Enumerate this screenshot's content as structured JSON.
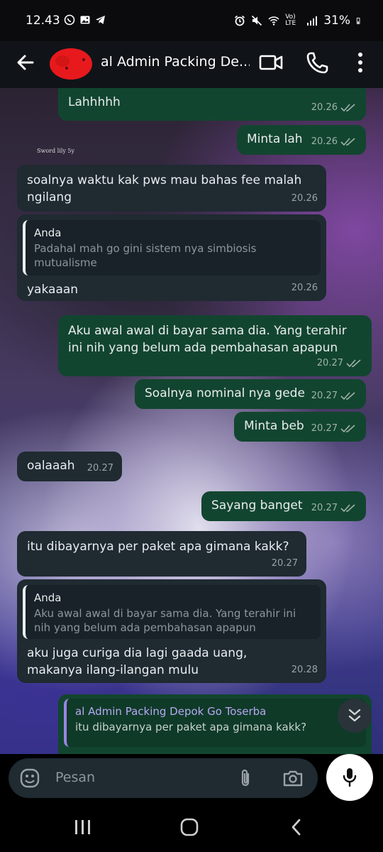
{
  "status_bar": {
    "time": "12.43",
    "battery": "31%",
    "network": "Vo) LTE",
    "icons": [
      "whatsapp-icon",
      "gallery-icon",
      "telegram-icon",
      "alarm-icon",
      "mute-icon",
      "wifi-icon",
      "signal-icon",
      "battery-icon"
    ]
  },
  "header": {
    "contact_name": "al Admin Packing De...",
    "icons": [
      "back-arrow-icon",
      "video-call-icon",
      "voice-call-icon",
      "more-vert-icon"
    ]
  },
  "chat": {
    "watermark": "Sword lily 5y",
    "messages": [
      {
        "direction": "out",
        "text": "Lahhhhh",
        "time": "20.26",
        "status": "read"
      },
      {
        "direction": "out",
        "text": "Minta lah",
        "time": "20.26",
        "status": "read"
      },
      {
        "direction": "in",
        "text": "soalnya waktu kak pws mau bahas fee malah ngilang",
        "time": "20.26"
      },
      {
        "direction": "in",
        "quote_name": "Anda",
        "quote_text": "Padahal mah go gini sistem nya simbiosis mutualisme",
        "text": "yakaaan",
        "time": "20.26"
      },
      {
        "direction": "out",
        "text": "Aku awal awal di bayar sama dia. Yang terahir ini nih yang  belum ada pembahasan apapun",
        "time": "20.27",
        "status": "read"
      },
      {
        "direction": "out",
        "text": "Soalnya nominal nya gede",
        "time": "20.27",
        "status": "read"
      },
      {
        "direction": "out",
        "text": "Minta beb",
        "time": "20.27",
        "status": "read"
      },
      {
        "direction": "in",
        "text": "oalaaah",
        "time": "20.27"
      },
      {
        "direction": "out",
        "text": "Sayang banget",
        "time": "20.27",
        "status": "read"
      },
      {
        "direction": "in",
        "text": "itu dibayarnya per paket apa gimana kakk?",
        "time": "20.27"
      },
      {
        "direction": "in",
        "quote_name": "Anda",
        "quote_text": "Aku awal awal di bayar sama dia. Yang terahir ini nih yang  belum ada pembahasan apapun",
        "text": "aku juga curiga dia lagi gaada uang, makanya ilang-ilangan mulu",
        "time": "20.28"
      },
      {
        "direction": "out",
        "quote_name": "al Admin Packing Depok Go Toserba",
        "quote_text": "itu dibayarnya per paket apa gimana kakk?"
      }
    ]
  },
  "composer": {
    "placeholder": "Pesan",
    "icons": [
      "emoji-icon",
      "attach-icon",
      "camera-icon",
      "mic-icon"
    ]
  },
  "colors": {
    "outgoing_bubble": "#12452f",
    "incoming_bubble": "#1f2a31",
    "read_tick": "#9fb2ab",
    "quote_bar_outgoing": "#9a84e6"
  }
}
